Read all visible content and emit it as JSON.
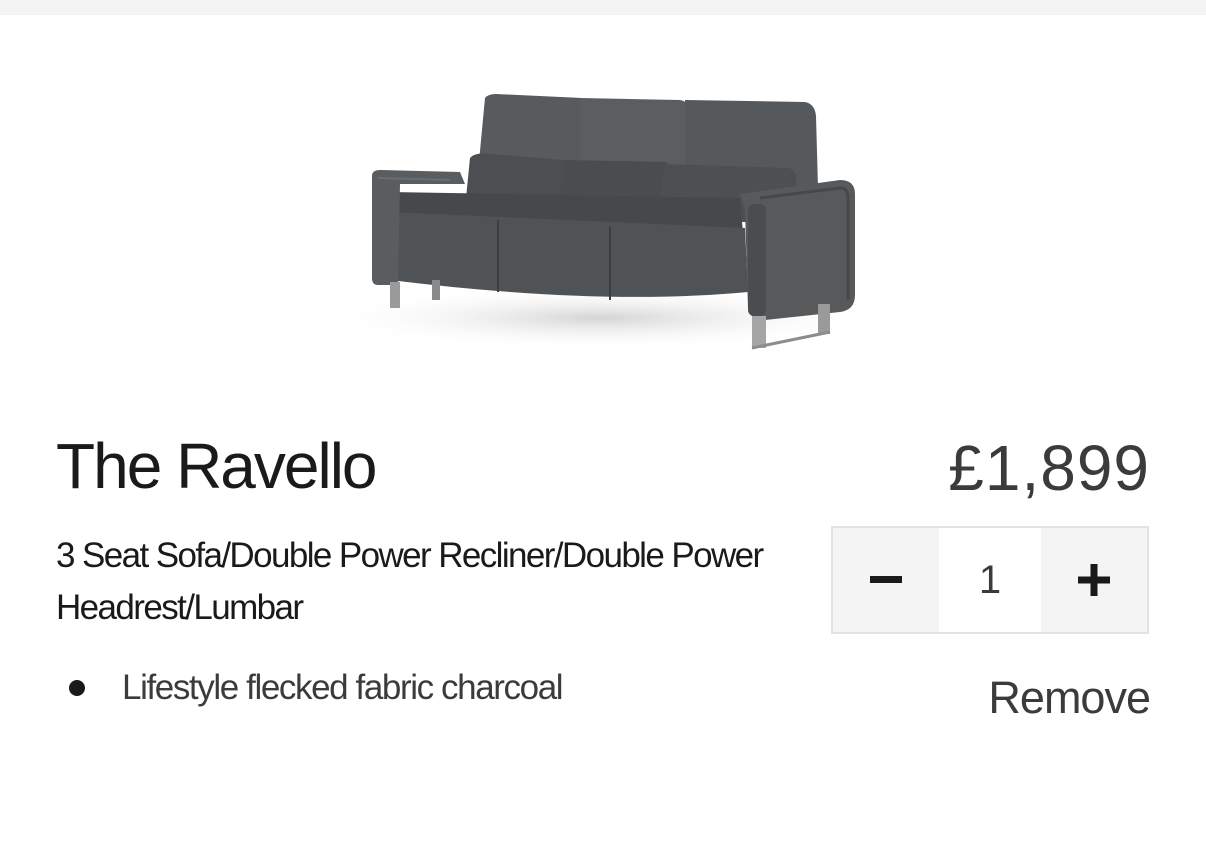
{
  "product": {
    "image_icon": "sofa-image",
    "image_alt": "Charcoal 3 seat sofa",
    "title": "The Ravello",
    "price": "£1,899",
    "description": "3 Seat Sofa/Double Power Recliner/Double Power Headrest/Lumbar",
    "features": [
      "Lifestyle flecked fabric charcoal"
    ]
  },
  "quantity": {
    "value": "1",
    "decrease_icon": "minus-icon",
    "increase_icon": "plus-icon"
  },
  "actions": {
    "remove_label": "Remove"
  },
  "colors": {
    "text_primary": "#1a1a1a",
    "text_secondary": "#3b3b3b",
    "stepper_bg": "#f4f4f4",
    "stepper_border": "#e2e2e2",
    "sofa_fabric": "#4f5254"
  }
}
